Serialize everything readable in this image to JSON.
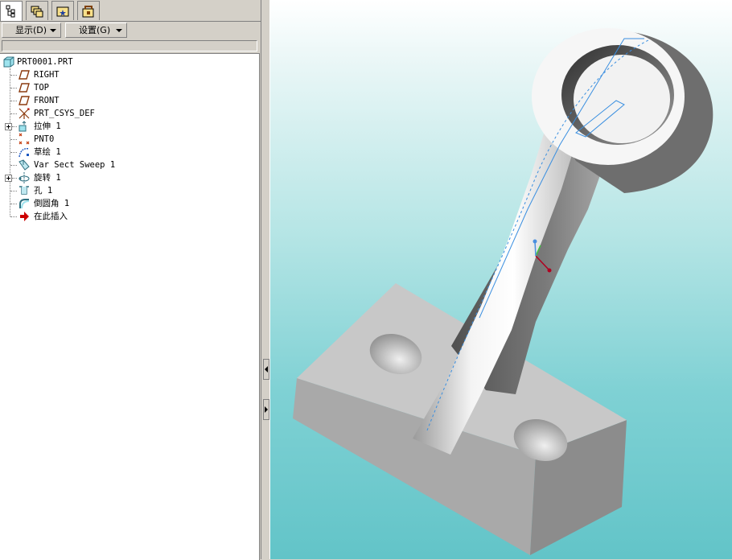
{
  "tabs": [
    {
      "name": "model-tree-tab",
      "icon": "model-tree-icon",
      "active": true
    },
    {
      "name": "layers-tab",
      "icon": "layers-icon",
      "active": false
    },
    {
      "name": "folder-browser-tab",
      "icon": "folder-icon",
      "active": false
    },
    {
      "name": "favorites-tab",
      "icon": "favorites-folder-icon",
      "active": false
    }
  ],
  "menu": {
    "display_label": "显示(D)",
    "settings_label": "设置(G)"
  },
  "tree": {
    "root": "PRT0001.PRT",
    "items": [
      {
        "label": "RIGHT",
        "icon": "datum-plane-icon",
        "expandable": false
      },
      {
        "label": "TOP",
        "icon": "datum-plane-icon",
        "expandable": false
      },
      {
        "label": "FRONT",
        "icon": "datum-plane-icon",
        "expandable": false
      },
      {
        "label": "PRT_CSYS_DEF",
        "icon": "coordinate-system-icon",
        "expandable": false
      },
      {
        "label": "拉伸 1",
        "icon": "extrude-icon",
        "expandable": true
      },
      {
        "label": "PNT0",
        "icon": "datum-point-icon",
        "expandable": false
      },
      {
        "label": "草绘 1",
        "icon": "sketch-icon",
        "expandable": false
      },
      {
        "label": "Var Sect Sweep 1",
        "icon": "sweep-icon",
        "expandable": false
      },
      {
        "label": "旋转 1",
        "icon": "revolve-icon",
        "expandable": true
      },
      {
        "label": "孔 1",
        "icon": "hole-icon",
        "expandable": false
      },
      {
        "label": "倒圆角 1",
        "icon": "round-icon",
        "expandable": false
      },
      {
        "label": "在此插入",
        "icon": "insert-here-arrow-icon",
        "expandable": false
      }
    ]
  },
  "colors": {
    "panel_bg": "#d4d0c8",
    "viewport_top": "#ffffff",
    "viewport_bottom": "#62c4c8",
    "model_gray": "#c0c0c0",
    "insert_arrow": "#cc0000"
  }
}
